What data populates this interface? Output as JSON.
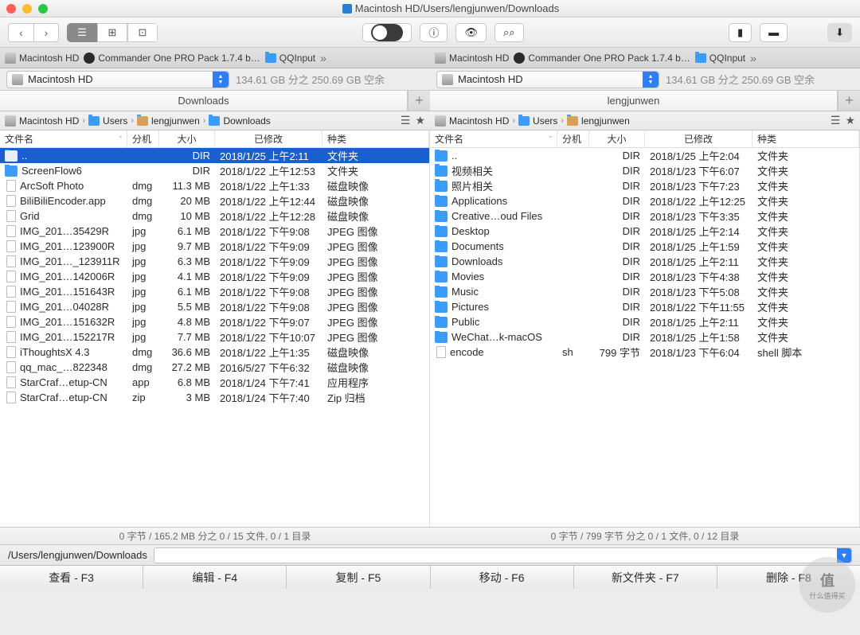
{
  "title": "Macintosh HD/Users/lengjunwen/Downloads",
  "tabs": {
    "t1": "Macintosh HD",
    "t2": "Commander One PRO Pack 1.7.4 b…",
    "t3": "QQInput"
  },
  "volume": {
    "name": "Macintosh HD",
    "space": "134.61 GB 分之 250.69 GB 空余"
  },
  "left": {
    "tab": "Downloads",
    "crumbs": [
      "Macintosh HD",
      "Users",
      "lengjunwen",
      "Downloads"
    ],
    "stats": "0 字节 / 165.2 MB 分之 0 / 15 文件, 0 / 1 目录"
  },
  "right": {
    "tab": "lengjunwen",
    "crumbs": [
      "Macintosh HD",
      "Users",
      "lengjunwen"
    ],
    "stats": "0 字节 / 799 字节 分之 0 / 1 文件, 0 / 12 目录"
  },
  "headers": {
    "name": "文件名",
    "ext": "分机",
    "size": "大小",
    "date": "已修改",
    "kind": "种类"
  },
  "leftFiles": [
    {
      "icon": "fold",
      "name": "..",
      "ext": "",
      "size": "DIR",
      "date": "2018/1/25 上午2:11",
      "kind": "文件夹",
      "sel": true
    },
    {
      "icon": "fold",
      "name": "ScreenFlow6",
      "ext": "",
      "size": "DIR",
      "date": "2018/1/22 上午12:53",
      "kind": "文件夹"
    },
    {
      "icon": "file",
      "name": "ArcSoft Photo",
      "ext": "dmg",
      "size": "11.3 MB",
      "date": "2018/1/22 上午1:33",
      "kind": "磁盘映像"
    },
    {
      "icon": "file",
      "name": "BiliBiliEncoder.app",
      "ext": "dmg",
      "size": "20 MB",
      "date": "2018/1/22 上午12:44",
      "kind": "磁盘映像"
    },
    {
      "icon": "file",
      "name": "Grid",
      "ext": "dmg",
      "size": "10 MB",
      "date": "2018/1/22 上午12:28",
      "kind": "磁盘映像"
    },
    {
      "icon": "file",
      "name": "IMG_201…35429R",
      "ext": "jpg",
      "size": "6.1 MB",
      "date": "2018/1/22 下午9:08",
      "kind": "JPEG 图像"
    },
    {
      "icon": "file",
      "name": "IMG_201…123900R",
      "ext": "jpg",
      "size": "9.7 MB",
      "date": "2018/1/22 下午9:09",
      "kind": "JPEG 图像"
    },
    {
      "icon": "file",
      "name": "IMG_201…_123911R",
      "ext": "jpg",
      "size": "6.3 MB",
      "date": "2018/1/22 下午9:09",
      "kind": "JPEG 图像"
    },
    {
      "icon": "file",
      "name": "IMG_201…142006R",
      "ext": "jpg",
      "size": "4.1 MB",
      "date": "2018/1/22 下午9:09",
      "kind": "JPEG 图像"
    },
    {
      "icon": "file",
      "name": "IMG_201…151643R",
      "ext": "jpg",
      "size": "6.1 MB",
      "date": "2018/1/22 下午9:08",
      "kind": "JPEG 图像"
    },
    {
      "icon": "file",
      "name": "IMG_201…04028R",
      "ext": "jpg",
      "size": "5.5 MB",
      "date": "2018/1/22 下午9:08",
      "kind": "JPEG 图像"
    },
    {
      "icon": "file",
      "name": "IMG_201…151632R",
      "ext": "jpg",
      "size": "4.8 MB",
      "date": "2018/1/22 下午9:07",
      "kind": "JPEG 图像"
    },
    {
      "icon": "file",
      "name": "IMG_201…152217R",
      "ext": "jpg",
      "size": "7.7 MB",
      "date": "2018/1/22 下午10:07",
      "kind": "JPEG 图像"
    },
    {
      "icon": "file",
      "name": "iThoughtsX 4.3",
      "ext": "dmg",
      "size": "36.6 MB",
      "date": "2018/1/22 上午1:35",
      "kind": "磁盘映像"
    },
    {
      "icon": "file",
      "name": "qq_mac_…822348",
      "ext": "dmg",
      "size": "27.2 MB",
      "date": "2016/5/27 下午6:32",
      "kind": "磁盘映像"
    },
    {
      "icon": "file",
      "name": "StarCraf…etup-CN",
      "ext": "app",
      "size": "6.8 MB",
      "date": "2018/1/24 下午7:41",
      "kind": "应用程序"
    },
    {
      "icon": "file",
      "name": "StarCraf…etup-CN",
      "ext": "zip",
      "size": "3 MB",
      "date": "2018/1/24 下午7:40",
      "kind": "Zip 归档"
    }
  ],
  "rightFiles": [
    {
      "icon": "fold",
      "name": "..",
      "ext": "",
      "size": "DIR",
      "date": "2018/1/25 上午2:04",
      "kind": "文件夹"
    },
    {
      "icon": "fold",
      "name": "视频相关",
      "ext": "",
      "size": "DIR",
      "date": "2018/1/23 下午6:07",
      "kind": "文件夹"
    },
    {
      "icon": "fold",
      "name": "照片相关",
      "ext": "",
      "size": "DIR",
      "date": "2018/1/23 下午7:23",
      "kind": "文件夹"
    },
    {
      "icon": "fold",
      "name": "Applications",
      "ext": "",
      "size": "DIR",
      "date": "2018/1/22 上午12:25",
      "kind": "文件夹"
    },
    {
      "icon": "fold",
      "name": "Creative…oud Files",
      "ext": "",
      "size": "DIR",
      "date": "2018/1/23 下午3:35",
      "kind": "文件夹"
    },
    {
      "icon": "fold",
      "name": "Desktop",
      "ext": "",
      "size": "DIR",
      "date": "2018/1/25 上午2:14",
      "kind": "文件夹"
    },
    {
      "icon": "fold",
      "name": "Documents",
      "ext": "",
      "size": "DIR",
      "date": "2018/1/25 上午1:59",
      "kind": "文件夹"
    },
    {
      "icon": "fold",
      "name": "Downloads",
      "ext": "",
      "size": "DIR",
      "date": "2018/1/25 上午2:11",
      "kind": "文件夹"
    },
    {
      "icon": "fold",
      "name": "Movies",
      "ext": "",
      "size": "DIR",
      "date": "2018/1/23 下午4:38",
      "kind": "文件夹"
    },
    {
      "icon": "fold",
      "name": "Music",
      "ext": "",
      "size": "DIR",
      "date": "2018/1/23 下午5:08",
      "kind": "文件夹"
    },
    {
      "icon": "fold",
      "name": "Pictures",
      "ext": "",
      "size": "DIR",
      "date": "2018/1/22 下午11:55",
      "kind": "文件夹"
    },
    {
      "icon": "fold",
      "name": "Public",
      "ext": "",
      "size": "DIR",
      "date": "2018/1/25 上午2:11",
      "kind": "文件夹"
    },
    {
      "icon": "fold",
      "name": "WeChat…k-macOS",
      "ext": "",
      "size": "DIR",
      "date": "2018/1/25 上午1:58",
      "kind": "文件夹"
    },
    {
      "icon": "file",
      "name": "encode",
      "ext": "sh",
      "size": "799 字节",
      "date": "2018/1/23 下午6:04",
      "kind": "shell 脚本"
    }
  ],
  "path": "/Users/lengjunwen/Downloads",
  "fn": {
    "f3": "查看 - F3",
    "f4": "编辑 - F4",
    "f5": "复制 - F5",
    "f6": "移动 - F6",
    "f7": "新文件夹 - F7",
    "f8": "删除 - F8"
  },
  "watermark": {
    "big": "值",
    "small": "什么值得买"
  }
}
